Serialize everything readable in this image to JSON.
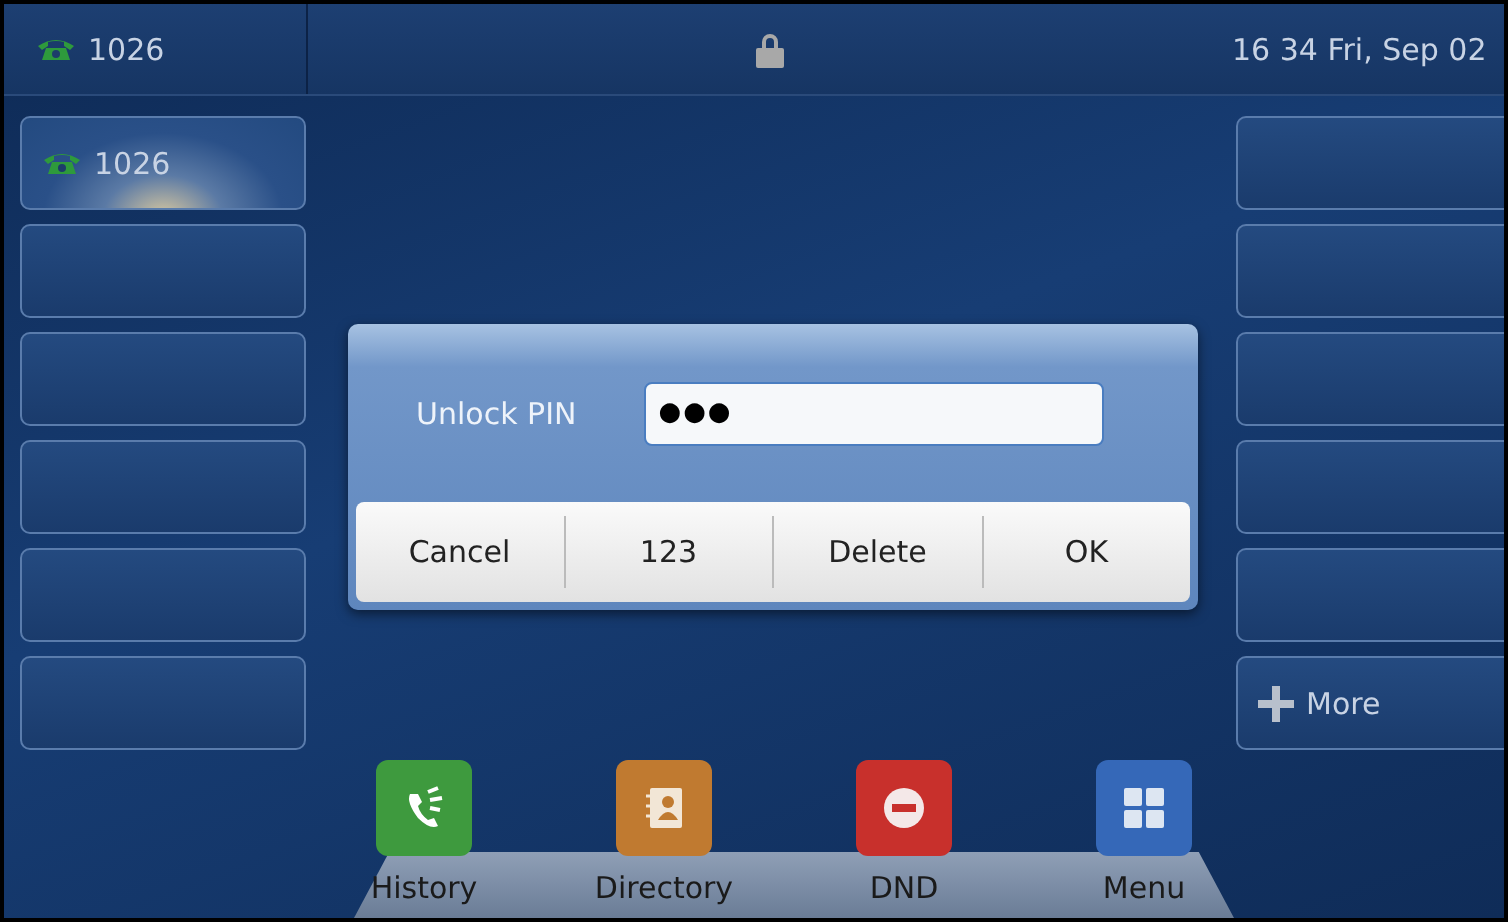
{
  "status_bar": {
    "account": "1026",
    "time": "16 34 Fri, Sep 02"
  },
  "left_keys": [
    {
      "kind": "account",
      "label": "1026"
    },
    {
      "kind": "empty"
    },
    {
      "kind": "empty"
    },
    {
      "kind": "empty"
    },
    {
      "kind": "empty"
    },
    {
      "kind": "empty"
    }
  ],
  "right_keys": [
    {
      "kind": "empty"
    },
    {
      "kind": "empty"
    },
    {
      "kind": "empty"
    },
    {
      "kind": "empty"
    },
    {
      "kind": "empty"
    },
    {
      "kind": "more",
      "label": "More"
    }
  ],
  "dialog": {
    "label": "Unlock PIN",
    "value": "●●●",
    "buttons": [
      "Cancel",
      "123",
      "Delete",
      "OK"
    ]
  },
  "dock": [
    {
      "kind": "history",
      "label": "History"
    },
    {
      "kind": "directory",
      "label": "Directory"
    },
    {
      "kind": "dnd",
      "label": "DND"
    },
    {
      "kind": "menu",
      "label": "Menu"
    }
  ]
}
